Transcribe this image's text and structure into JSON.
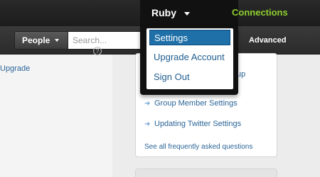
{
  "topbar": {
    "user_name": "Ruby",
    "brand_partial": "Connections"
  },
  "searchbar": {
    "scope_label": "People",
    "placeholder": "Search...",
    "advanced_label": "Advanced"
  },
  "left": {
    "upgrade_link": "Upgrade",
    "help_glyph": "?"
  },
  "card": {
    "partial_link": "bgroup",
    "links": [
      {
        "label": "Group Member Settings"
      },
      {
        "label": "Updating Twitter Settings"
      }
    ],
    "see_all": "See all frequently asked questions",
    "arrow_glyph": "➜"
  },
  "dropdown": {
    "items": [
      {
        "label": "Settings",
        "selected": true
      },
      {
        "label": "Upgrade Account",
        "selected": false
      },
      {
        "label": "Sign Out",
        "selected": false
      }
    ]
  },
  "colors": {
    "brand": "#8fcf2f",
    "link": "#2a6496",
    "selected_bg": "#1f6fa8"
  }
}
